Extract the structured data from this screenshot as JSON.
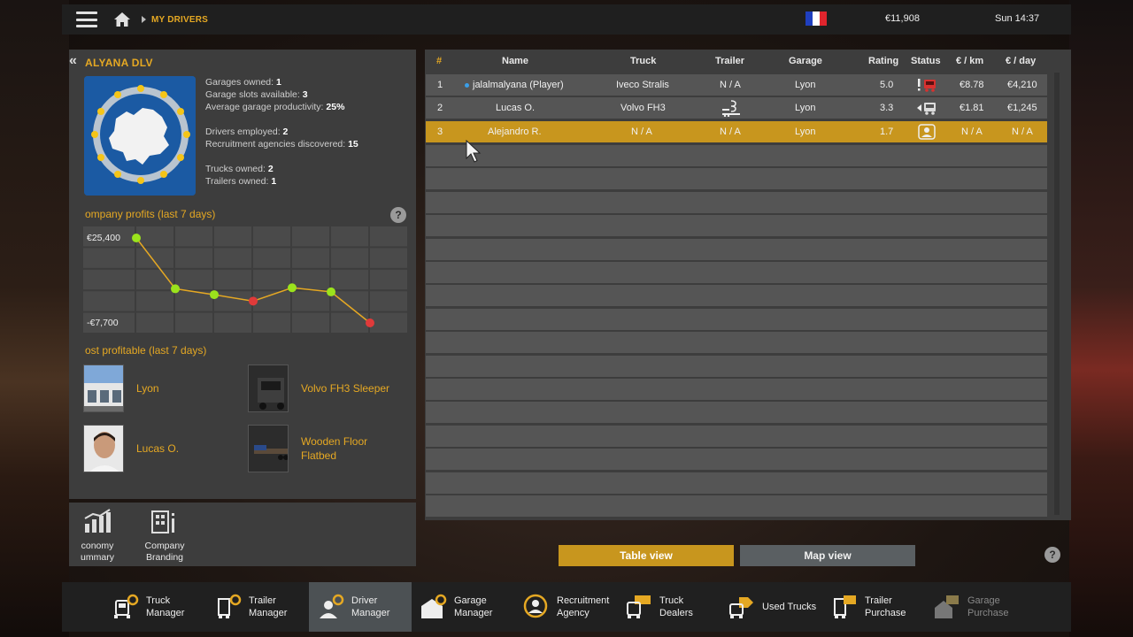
{
  "topbar": {
    "breadcrumb": "MY DRIVERS",
    "money": "€11,908",
    "time": "Sun 14:37"
  },
  "company": {
    "name": "ALYANA DLV",
    "stats": {
      "garages_owned_label": "Garages owned: ",
      "garages_owned": "1",
      "garage_slots_label": "Garage slots available: ",
      "garage_slots": "3",
      "productivity_label": "Average garage productivity: ",
      "productivity": "25%",
      "drivers_label": "Drivers employed: ",
      "drivers": "2",
      "agencies_label": "Recruitment agencies discovered: ",
      "agencies": "15",
      "trucks_label": "Trucks owned: ",
      "trucks": "2",
      "trailers_label": "Trailers owned: ",
      "trailers": "1"
    }
  },
  "profits": {
    "title": "ompany profits (last 7 days)",
    "top_label": "€25,400",
    "bottom_label": "-€7,700",
    "help": "?"
  },
  "chart_data": {
    "type": "line",
    "title": "ompany profits (last 7 days)",
    "x": [
      1,
      2,
      3,
      4,
      5,
      6,
      7
    ],
    "values": [
      25400,
      5600,
      3300,
      800,
      6000,
      4400,
      -7700
    ],
    "ylim": [
      -7700,
      25400
    ],
    "colors": {
      "line": "#e5a823",
      "positive": "#9be31c",
      "negative": "#e03a3a"
    }
  },
  "most_profitable": {
    "title": "ost profitable (last 7 days)",
    "garage": "Lyon",
    "truck": "Volvo FH3 Sleeper",
    "driver": "Lucas O.",
    "trailer_line1": "Wooden Floor",
    "trailer_line2": "Flatbed"
  },
  "left_bottom": {
    "economy_line1": "conomy",
    "economy_line2": "ummary",
    "branding_line1": "Company",
    "branding_line2": "Branding"
  },
  "table": {
    "headers": {
      "num": "#",
      "name": "Name",
      "truck": "Truck",
      "trailer": "Trailer",
      "garage": "Garage",
      "rating": "Rating",
      "status": "Status",
      "per_km": "€ / km",
      "per_day": "€ / day"
    },
    "rows": [
      {
        "num": "1",
        "name": "jalalmalyana (Player)",
        "truck": "Iveco Stralis",
        "trailer": "N / A",
        "garage": "Lyon",
        "rating": "5.0",
        "per_km": "€8.78",
        "per_day": "€4,210"
      },
      {
        "num": "2",
        "name": "Lucas O.",
        "truck": "Volvo FH3",
        "trailer": "",
        "garage": "Lyon",
        "rating": "3.3",
        "per_km": "€1.81",
        "per_day": "€1,245"
      },
      {
        "num": "3",
        "name": "Alejandro R.",
        "truck": "N / A",
        "trailer": "N / A",
        "garage": "Lyon",
        "rating": "1.7",
        "per_km": "N / A",
        "per_day": "N / A"
      }
    ]
  },
  "views": {
    "table": "Table view",
    "map": "Map view",
    "help": "?"
  },
  "toolbar": {
    "truck_manager_1": "Truck",
    "truck_manager_2": "Manager",
    "trailer_manager_1": "Trailer",
    "trailer_manager_2": "Manager",
    "driver_manager_1": "Driver",
    "driver_manager_2": "Manager",
    "garage_manager_1": "Garage",
    "garage_manager_2": "Manager",
    "recruitment_1": "Recruitment",
    "recruitment_2": "Agency",
    "truck_dealers_1": "Truck",
    "truck_dealers_2": "Dealers",
    "used_trucks": "Used Trucks",
    "trailer_purchase_1": "Trailer",
    "trailer_purchase_2": "Purchase",
    "garage_purchase_1": "Garage",
    "garage_purchase_2": "Purchase"
  },
  "colors": {
    "accent": "#e5a823",
    "selected_row": "#c8961e",
    "panel": "#3d3d3d",
    "row": "#555555"
  }
}
